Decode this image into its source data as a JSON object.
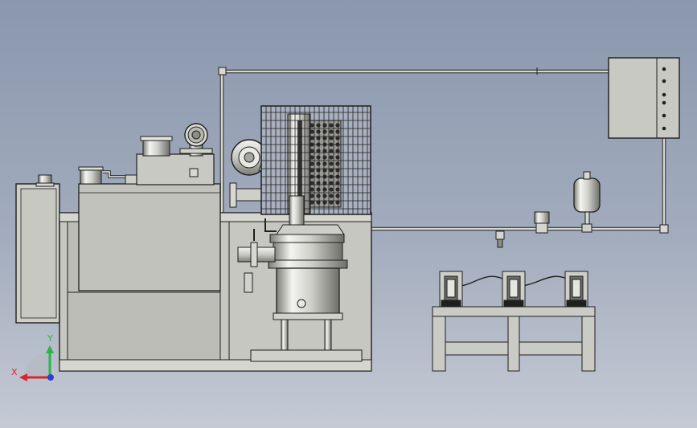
{
  "colors": {
    "background_top": "#8a97ad",
    "background_bottom": "#c5cad4",
    "metal": "#cfcfc9",
    "metal_light": "#eeeeea",
    "metal_dark": "#8c8c86",
    "outline": "#1e1e1e",
    "axis_x": "#d8262c",
    "axis_y": "#2bb34a",
    "axis_z": "#2a3fd6"
  },
  "triad": {
    "x_label": "X",
    "y_label": "Y"
  },
  "components": [
    "electric-heater-box",
    "main-frame",
    "reservoir-tank",
    "top-filter-housing",
    "pressure-gauge",
    "blower-fan",
    "caged-heat-exchanger",
    "vertical-column-vessel",
    "pipe-network",
    "expansion-tank",
    "pipe-valve",
    "control-cabinet",
    "equipment-table",
    "cylinder-canisters"
  ]
}
